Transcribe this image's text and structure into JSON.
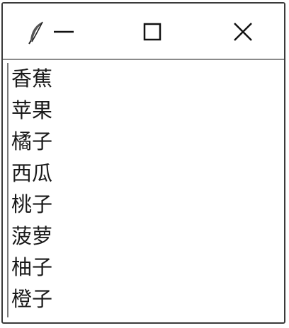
{
  "window": {
    "icon": "feather-icon",
    "controls": [
      "minimize-icon",
      "maximize-icon",
      "close-icon"
    ]
  },
  "listbox": {
    "items": [
      "香蕉",
      "苹果",
      "橘子",
      "西瓜",
      "桃子",
      "菠萝",
      "柚子",
      "橙子"
    ]
  }
}
